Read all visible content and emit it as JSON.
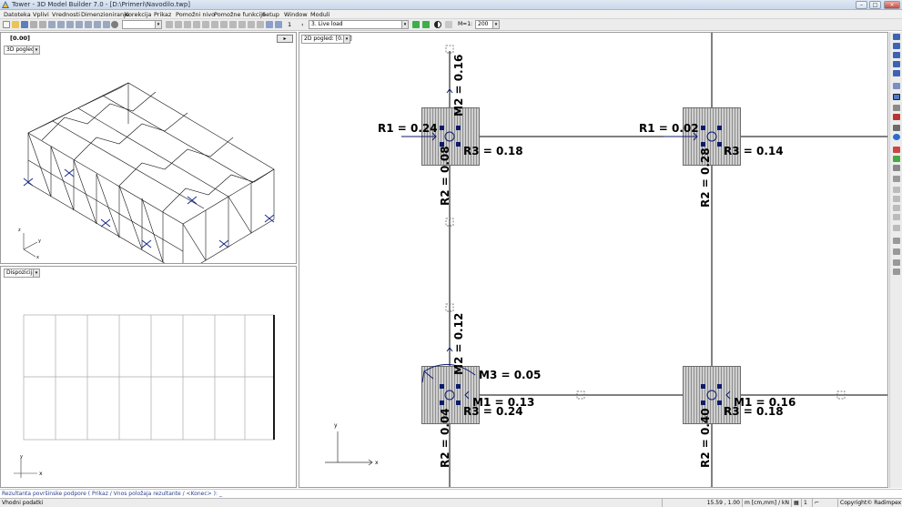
{
  "window": {
    "title": "Tower - 3D Model Builder 7.0 - [D:\\Primeri\\Navodilo.twp]"
  },
  "menu": {
    "items": [
      "Datoteka",
      "Vplivi",
      "Vrednosti",
      "Dimenzioniranje",
      "Korekcija",
      "Prikaz",
      "Pomožni nivo",
      "Pomožne funkcije",
      "Setup",
      "Window",
      "Moduli"
    ]
  },
  "toolbar": {
    "spin_value": "1",
    "load_case": "3. Live load",
    "scale_label": "M=1:",
    "scale_value": "200"
  },
  "top_left_panel": {
    "title": "[0.00]",
    "view_combo": "3D pogled",
    "nav_button": "▸"
  },
  "bottom_left_panel": {
    "view_combo": "Dispozicija"
  },
  "right_panel": {
    "view_combo": "2D pogled: [0.00]",
    "labels": {
      "f1_r1": "R1 = 0.24",
      "f1_r3": "R3 = 0.18",
      "f1_m2": "M2 = 0.16",
      "f1_r2": "R2 = 0.08",
      "f2_r1": "R1 = 0.02",
      "f2_r3": "R3 = 0.14",
      "f2_r2": "R2 = 0.28",
      "f3_m2": "M2 = 0.12",
      "f3_m3": "M3 = 0.05",
      "f3_m1": "M1 = 0.13",
      "f3_r3": "R3 = 0.24",
      "f3_r2": "R2 = 0.04",
      "f4_m1": "M1 = 0.16",
      "f4_r3": "R3 = 0.18",
      "f4_r2": "R2 = 0.40"
    }
  },
  "axes": {
    "x": "x",
    "y": "y",
    "z": "z"
  },
  "command_line": "Rezultanta površinske podpore ( Prikaz / Vnos položaja rezultante / <Konec> ): _",
  "status": {
    "left": "Vhodni podatki",
    "coords": "15.59 , 1.00",
    "units": "m [cm,mm] / kN",
    "copyright": "Copyright© Radimpex",
    "page_num": "1"
  },
  "colors": {
    "moment_arrow": "#1a2a8c",
    "footing_hatch": "#8e8e8e"
  }
}
